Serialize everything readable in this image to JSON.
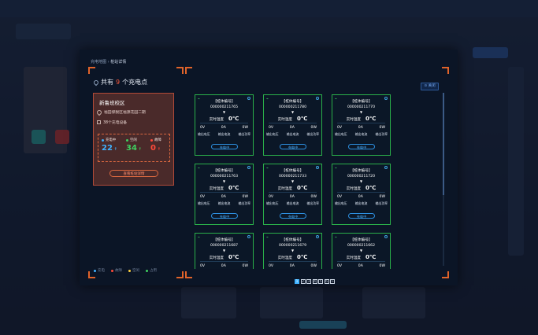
{
  "breadcrumb": {
    "root": "充电地图",
    "current": "桩站详情"
  },
  "header": {
    "prefix": "共有",
    "count": "9",
    "suffix": "个充电点"
  },
  "close_label": "关闭",
  "site": {
    "name": "新鲁班校区",
    "address": "福田保税区福源花园二期",
    "device_count": "38个充电设备",
    "stats": [
      {
        "label": "充电中",
        "value": "22",
        "color": "#3fb2ff"
      },
      {
        "label": "空闲",
        "value": "34",
        "color": "#3fd060"
      },
      {
        "label": "故障",
        "value": "0",
        "color": "#ff4a3a"
      }
    ],
    "view_button": "查看桩站详情"
  },
  "legend": [
    {
      "label": "充电",
      "color": "#3fb2ff"
    },
    {
      "label": "故障",
      "color": "#ff4a3a"
    },
    {
      "label": "空闲",
      "color": "#ffd23f"
    },
    {
      "label": "占用",
      "color": "#3fd060"
    }
  ],
  "card_labels": {
    "pile_no": "【桩体编号】",
    "arrow": "▼",
    "temp_label": "实时温度",
    "temp_value": "0℃",
    "voltage": "0V",
    "current": "0A",
    "power": "0W",
    "voltage_label": "输出电压",
    "current_label": "输出电流",
    "power_label": "输出功率"
  },
  "piles": [
    {
      "id": "000000211765",
      "status": "充电中"
    },
    {
      "id": "000000211780",
      "status": "充电中"
    },
    {
      "id": "000000211770",
      "status": "充电中"
    },
    {
      "id": "000000211763",
      "status": "充电中"
    },
    {
      "id": "000000211733",
      "status": "充电中"
    },
    {
      "id": "000000211720",
      "status": "充电中"
    },
    {
      "id": "000000211687",
      "status": "充电中"
    },
    {
      "id": "000000211679",
      "status": "充电中"
    },
    {
      "id": "000000211662",
      "status": "充电中"
    }
  ],
  "pagination": {
    "pages": [
      "1",
      "2",
      "3",
      "4",
      "5",
      "6"
    ],
    "next": ">",
    "active": "1"
  }
}
